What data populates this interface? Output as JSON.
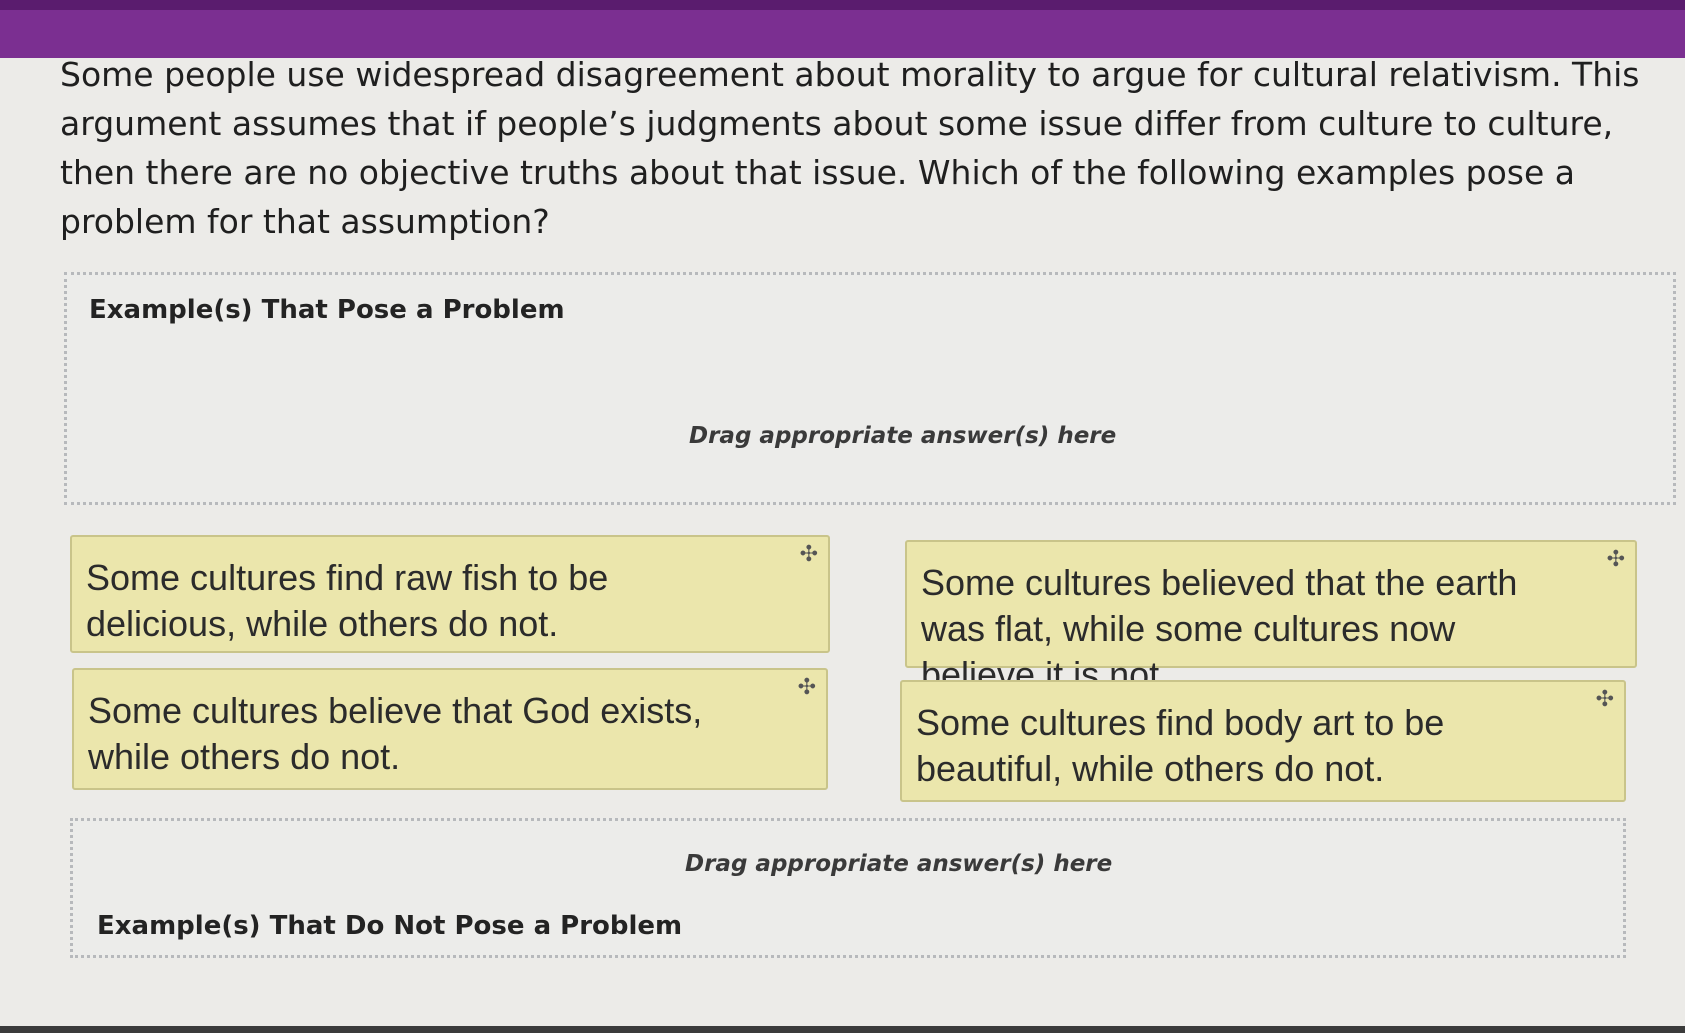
{
  "question": {
    "text": "Some people use widespread disagreement about morality to argue for cultural relativism. This argument assumes that if people’s judgments about some issue differ from culture to culture, then there are no objective truths about that issue. Which of the following examples pose a problem for that assumption?"
  },
  "zones": {
    "problem": {
      "title": "Example(s) That Pose a Problem",
      "hint": "Drag appropriate answer(s) here"
    },
    "no_problem": {
      "title": "Example(s) That Do Not Pose a Problem",
      "hint": "Drag appropriate answer(s) here"
    }
  },
  "answers": [
    {
      "text": "Some cultures find raw fish to be delicious, while others do not.",
      "icon": "move-icon"
    },
    {
      "text": "Some cultures believed that the earth was flat, while some cultures now believe it is not.",
      "icon": "move-icon"
    },
    {
      "text": "Some cultures believe that God exists, while others do not.",
      "icon": "move-icon"
    },
    {
      "text": "Some cultures find body art to be beautiful, while others do not.",
      "icon": "move-icon"
    }
  ],
  "colors": {
    "header": "#7b2f91",
    "card": "#ebe6ac",
    "background": "#ecebe8"
  }
}
